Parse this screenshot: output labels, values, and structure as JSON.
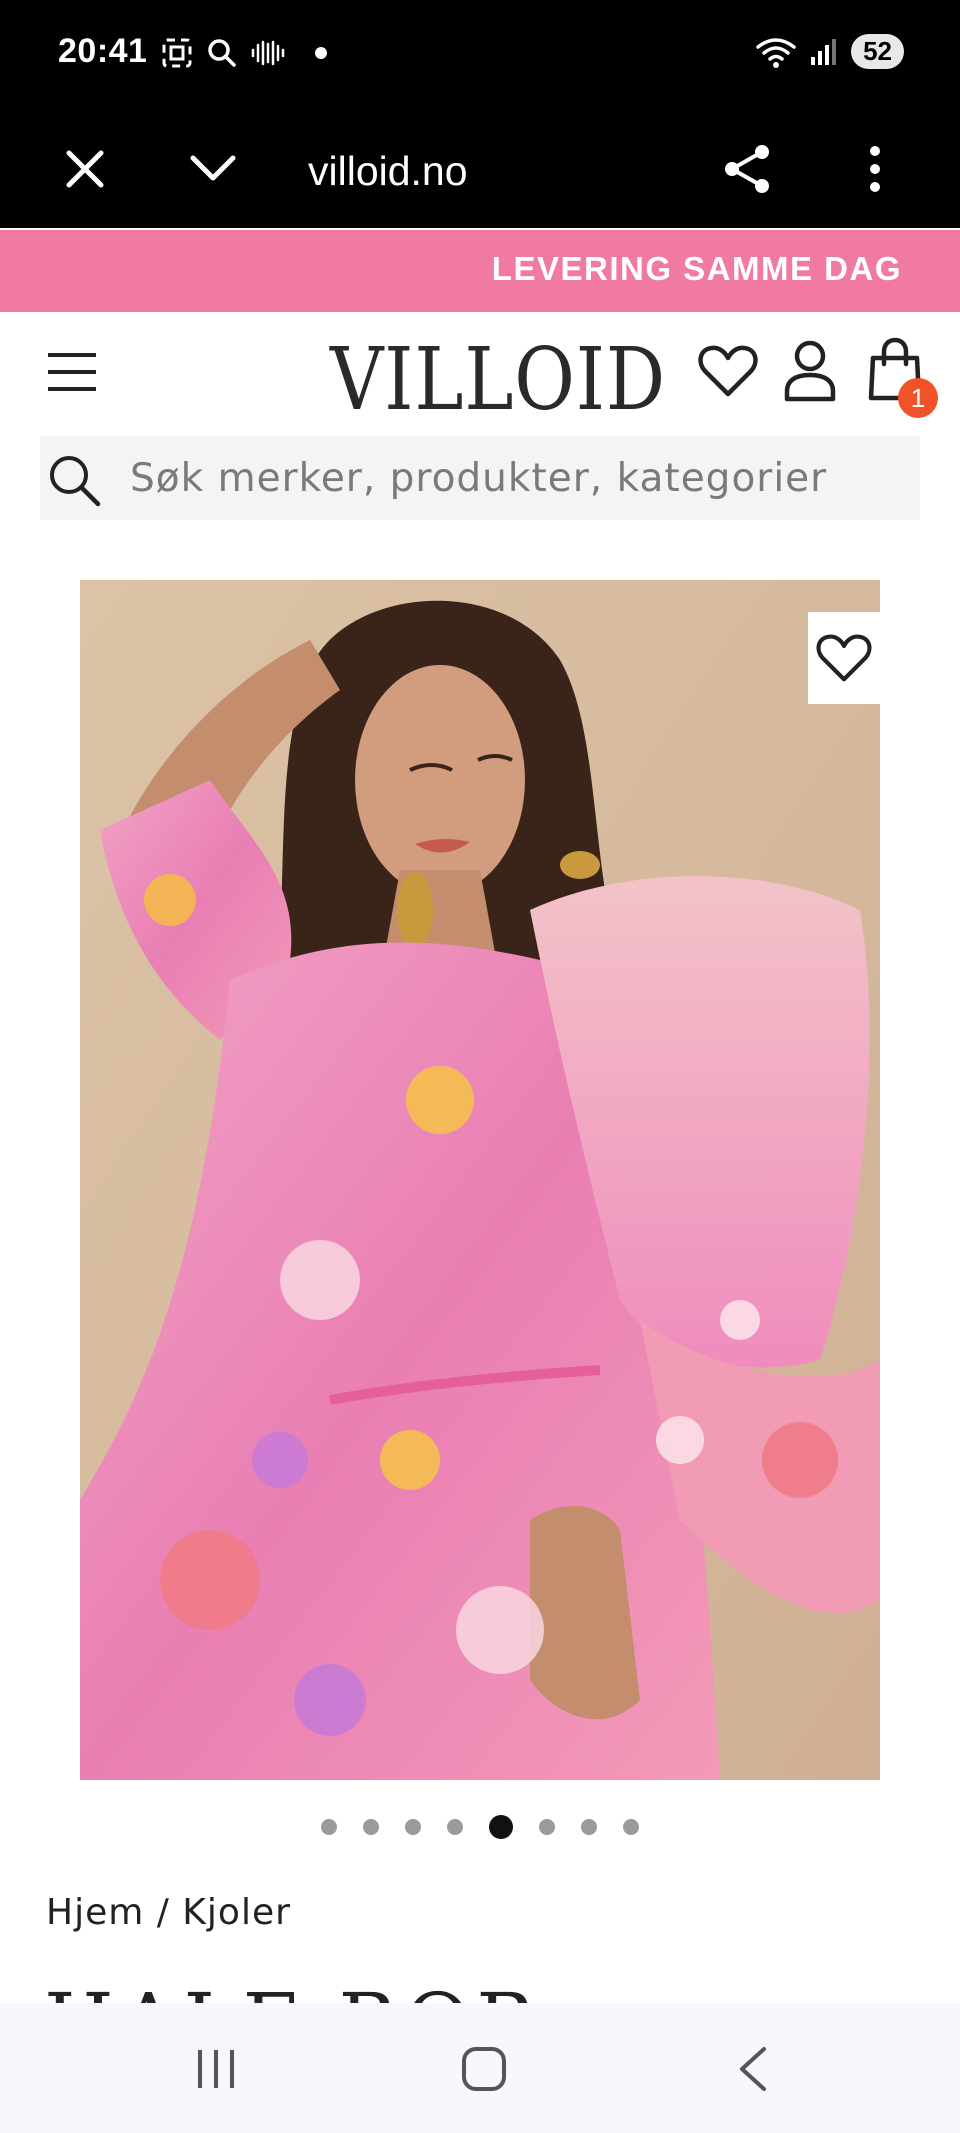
{
  "status_bar": {
    "time": "20:41",
    "battery": "52",
    "icons_left": [
      "screenshot-icon",
      "search-icon",
      "sound-wave-icon",
      "dot-icon"
    ],
    "icons_right": [
      "wifi-icon",
      "signal-icon"
    ]
  },
  "browser": {
    "url": "villoid.no",
    "buttons": [
      "close-icon",
      "chevron-down-icon",
      "share-icon",
      "more-vert-icon"
    ]
  },
  "promo": {
    "text": "LEVERING SAMME DAG",
    "color": "#f07aa0"
  },
  "header": {
    "logo": "VILLOID",
    "cart_count": "1",
    "badge_color": "#f0522a"
  },
  "search": {
    "placeholder": "Søk merker, produkter, kategorier"
  },
  "product": {
    "image_alt": "Model in pink floral dress",
    "carousel_total": 8,
    "carousel_active_index": 4,
    "breadcrumb": "Hjem / Kjoler",
    "title_partial": "HALE BOB"
  },
  "nav": {
    "buttons": [
      "recent-apps-icon",
      "home-icon",
      "back-icon"
    ]
  }
}
